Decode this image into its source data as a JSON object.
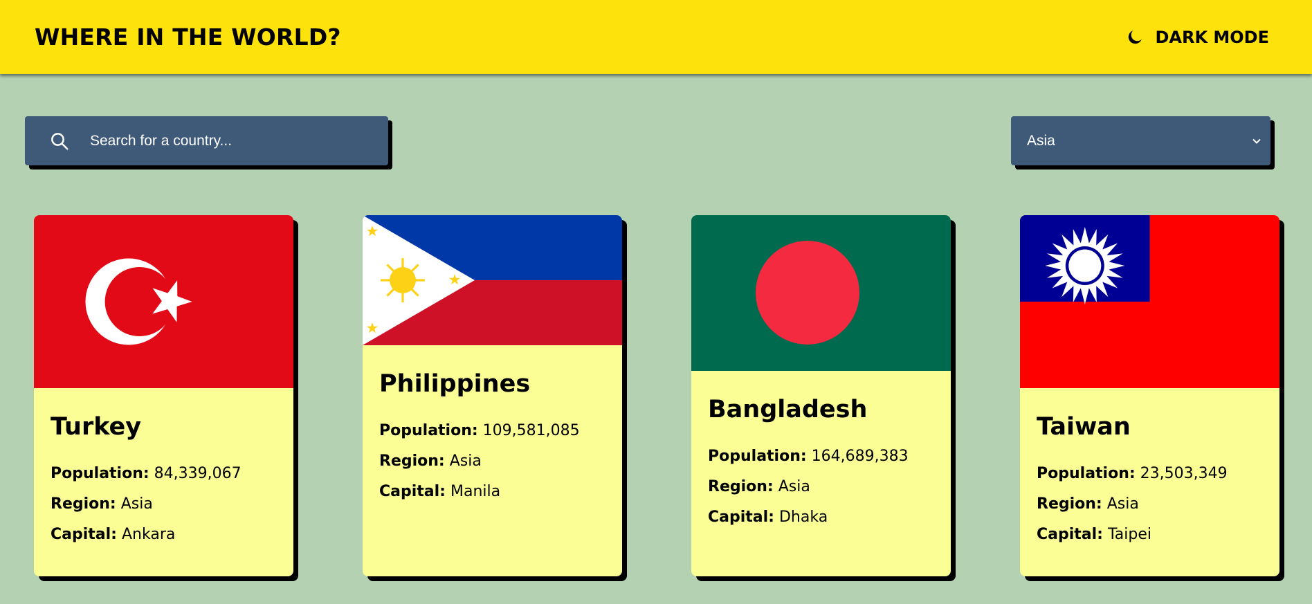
{
  "header": {
    "title": "WHERE IN THE WORLD?",
    "mode_toggle_label": "DARK MODE",
    "mode_icon": "moon-icon"
  },
  "search": {
    "placeholder": "Search for a country...",
    "value": "",
    "icon": "search-icon"
  },
  "filter": {
    "selected": "Asia",
    "icon": "chevron-down-icon"
  },
  "stat_labels": {
    "population": "Population:",
    "region": "Region:",
    "capital": "Capital:"
  },
  "countries": [
    {
      "name": "Turkey",
      "population": "84,339,067",
      "region": "Asia",
      "capital": "Ankara"
    },
    {
      "name": "Philippines",
      "population": "109,581,085",
      "region": "Asia",
      "capital": "Manila"
    },
    {
      "name": "Bangladesh",
      "population": "164,689,383",
      "region": "Asia",
      "capital": "Dhaka"
    },
    {
      "name": "Taiwan",
      "population": "23,503,349",
      "region": "Asia",
      "capital": "Taipei"
    }
  ],
  "colors": {
    "background": "#b4d2b1",
    "header": "#fde20c",
    "control": "#3f5a79",
    "card": "#fbfd95"
  }
}
